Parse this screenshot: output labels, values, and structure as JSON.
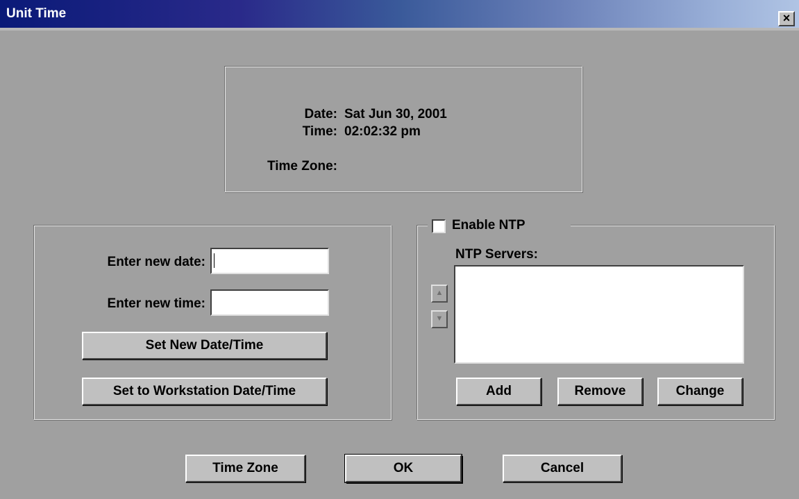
{
  "window": {
    "title": "Unit Time",
    "close_glyph": "×"
  },
  "current": {
    "date_label": "Date:",
    "date_value": "Sat Jun 30, 2001",
    "time_label": "Time:",
    "time_value": "02:02:32 pm",
    "tz_label": "Time Zone:",
    "tz_value": ""
  },
  "set_time": {
    "date_label": "Enter new date:",
    "date_value": "",
    "time_label": "Enter new time:",
    "time_value": "",
    "set_button": "Set New Date/Time",
    "workstation_button": "Set to Workstation Date/Time"
  },
  "ntp": {
    "enable_label": "Enable NTP",
    "enabled": false,
    "servers_label": "NTP Servers:",
    "servers": [],
    "up_icon": "arrow-up-icon",
    "down_icon": "arrow-down-icon",
    "add_button": "Add",
    "remove_button": "Remove",
    "change_button": "Change"
  },
  "footer": {
    "timezone_button": "Time Zone",
    "ok_button": "OK",
    "cancel_button": "Cancel"
  },
  "colors": {
    "dialog_bg": "#a0a0a0",
    "title_start": "#0a1a78",
    "title_end": "#b0c4e4"
  }
}
